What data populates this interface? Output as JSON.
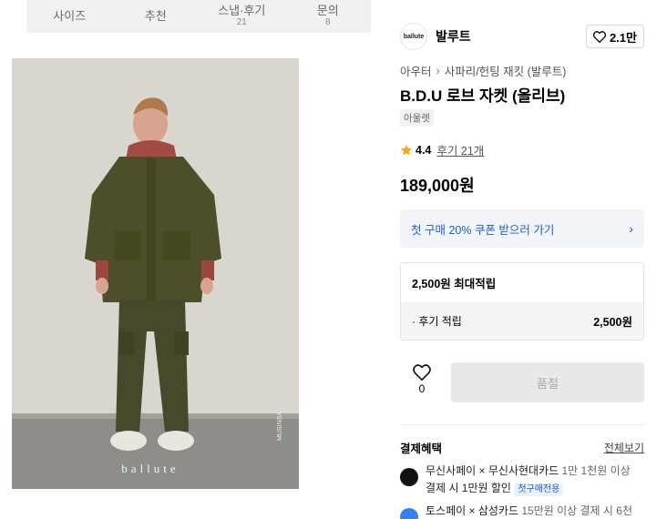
{
  "tabs": [
    {
      "label": "사이즈",
      "count": ""
    },
    {
      "label": "추천",
      "count": ""
    },
    {
      "label": "스냅·후기",
      "count": "21"
    },
    {
      "label": "문의",
      "count": "8"
    }
  ],
  "product_image": {
    "watermark": "ballute",
    "side_text": "MUSINSA"
  },
  "brand": {
    "logo_text": "ballute",
    "name": "발루트",
    "likes": "2.1만"
  },
  "breadcrumb": {
    "category": "아우터",
    "subcategory": "사파리/헌팅 재킷 (발루트)"
  },
  "product": {
    "title": "B.D.U 로브 자켓 (올리브)",
    "tag": "아울렛",
    "rating": "4.4",
    "review_text": "후기 21개",
    "price": "189,000원"
  },
  "coupon": {
    "text": "첫 구매 20% 쿠폰 받으러 가기"
  },
  "points": {
    "max_label": "2,500원 최대적립",
    "review_label": "· 후기 적립",
    "review_value": "2,500원"
  },
  "actions": {
    "wish_count": "0",
    "buy_label": "품절"
  },
  "benefits": {
    "header": "결제혜택",
    "see_all": "전체보기",
    "items": [
      {
        "title": "무신사페이 × 무신사현대카드",
        "detail": " 1만 1천원 이상",
        "line2": "결제 시 1만원 할인",
        "badge": "첫구매전용",
        "icon_color": "#111111"
      },
      {
        "title": "토스페이 × 삼성카드",
        "detail": " 15만원 이상 결제 시 6천",
        "line2": "",
        "badge": "",
        "icon_color": "#3182f6"
      }
    ]
  },
  "colors": {
    "accent_blue": "#1a5fd0",
    "star": "#f5a623",
    "soldout_bg": "#e8e8e8"
  }
}
